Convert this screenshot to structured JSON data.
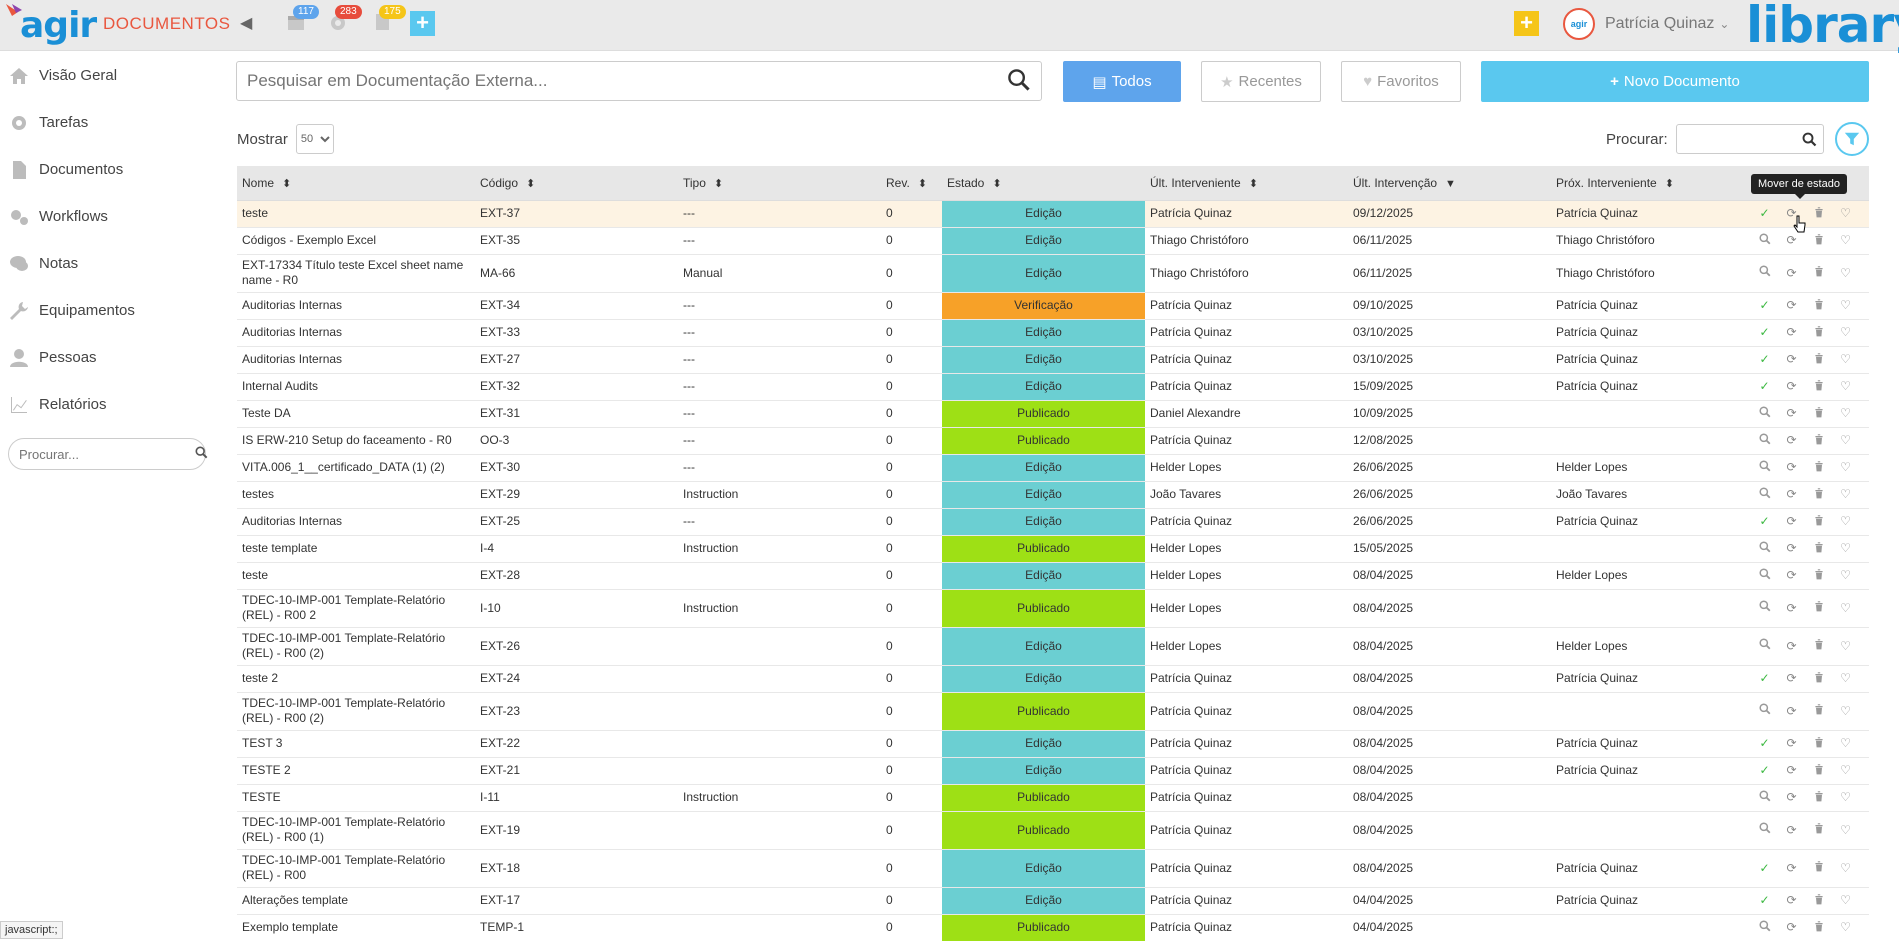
{
  "app": {
    "logo": "agir",
    "name": "DOCUMENTOS",
    "brand": "library",
    "user_name": "Patrícia Quinaz",
    "user_avatar_text": "agir",
    "badges": {
      "tasks": "117",
      "alerts": "283",
      "docs": "175"
    },
    "accent": "#1a8fd6",
    "brand_orange": "#e9573f"
  },
  "sidebar": {
    "items": [
      {
        "label": "Visão Geral",
        "icon": "home-icon"
      },
      {
        "label": "Tarefas",
        "icon": "gear-icon"
      },
      {
        "label": "Documentos",
        "icon": "document-icon"
      },
      {
        "label": "Workflows",
        "icon": "gears-icon"
      },
      {
        "label": "Notas",
        "icon": "comments-icon"
      },
      {
        "label": "Equipamentos",
        "icon": "wrench-icon"
      },
      {
        "label": "Pessoas",
        "icon": "user-icon"
      },
      {
        "label": "Relatórios",
        "icon": "chart-icon"
      }
    ],
    "search_placeholder": "Procurar..."
  },
  "toolbar": {
    "search_placeholder": "Pesquisar em Documentação Externa...",
    "all_label": "Todos",
    "recent_label": "Recentes",
    "favorites_label": "Favoritos",
    "new_label": "Novo Documento",
    "show_label": "Mostrar",
    "show_value": "50",
    "search_label": "Procurar:"
  },
  "table": {
    "headers": {
      "nome": "Nome",
      "codigo": "Código",
      "tipo": "Tipo",
      "rev": "Rev.",
      "estado": "Estado",
      "ult_int": "Últ. Interveniente",
      "ult_date": "Últ. Intervenção",
      "prox": "Próx. Interveniente"
    },
    "rows": [
      {
        "nome": "teste",
        "codigo": "EXT-37",
        "tipo": "---",
        "rev": "0",
        "estado": "Edição",
        "ult": "Patrícia Quinaz",
        "data": "09/12/2025",
        "prox": "Patrícia Quinaz",
        "check": true,
        "hl": true
      },
      {
        "nome": "Códigos - Exemplo Excel",
        "codigo": "EXT-35",
        "tipo": "---",
        "rev": "0",
        "estado": "Edição",
        "ult": "Thiago Christóforo",
        "data": "06/11/2025",
        "prox": "Thiago Christóforo",
        "check": false
      },
      {
        "nome": "EXT-17334 Título teste Excel sheet name name - R0",
        "codigo": "MA-66",
        "tipo": "Manual",
        "rev": "0",
        "estado": "Edição",
        "ult": "Thiago Christóforo",
        "data": "06/11/2025",
        "prox": "Thiago Christóforo",
        "check": false,
        "tall": true
      },
      {
        "nome": "Auditorias Internas",
        "codigo": "EXT-34",
        "tipo": "---",
        "rev": "0",
        "estado": "Verificação",
        "ult": "Patrícia Quinaz",
        "data": "09/10/2025",
        "prox": "Patrícia Quinaz",
        "check": true
      },
      {
        "nome": "Auditorias Internas",
        "codigo": "EXT-33",
        "tipo": "---",
        "rev": "0",
        "estado": "Edição",
        "ult": "Patrícia Quinaz",
        "data": "03/10/2025",
        "prox": "Patrícia Quinaz",
        "check": true
      },
      {
        "nome": "Auditorias Internas",
        "codigo": "EXT-27",
        "tipo": "---",
        "rev": "0",
        "estado": "Edição",
        "ult": "Patrícia Quinaz",
        "data": "03/10/2025",
        "prox": "Patrícia Quinaz",
        "check": true
      },
      {
        "nome": "Internal Audits",
        "codigo": "EXT-32",
        "tipo": "---",
        "rev": "0",
        "estado": "Edição",
        "ult": "Patrícia Quinaz",
        "data": "15/09/2025",
        "prox": "Patrícia Quinaz",
        "check": true
      },
      {
        "nome": "Teste DA",
        "codigo": "EXT-31",
        "tipo": "---",
        "rev": "0",
        "estado": "Publicado",
        "ult": "Daniel Alexandre",
        "data": "10/09/2025",
        "prox": "",
        "check": false
      },
      {
        "nome": "IS ERW-210 Setup do faceamento - R0",
        "codigo": "OO-3",
        "tipo": "---",
        "rev": "0",
        "estado": "Publicado",
        "ult": "Patrícia Quinaz",
        "data": "12/08/2025",
        "prox": "",
        "check": false
      },
      {
        "nome": "VITA.006_1__certificado_DATA (1) (2)",
        "codigo": "EXT-30",
        "tipo": "---",
        "rev": "0",
        "estado": "Edição",
        "ult": "Helder Lopes",
        "data": "26/06/2025",
        "prox": "Helder Lopes",
        "check": false
      },
      {
        "nome": "testes",
        "codigo": "EXT-29",
        "tipo": "Instruction",
        "rev": "0",
        "estado": "Edição",
        "ult": "João Tavares",
        "data": "26/06/2025",
        "prox": "João Tavares",
        "check": false
      },
      {
        "nome": "Auditorias Internas",
        "codigo": "EXT-25",
        "tipo": "---",
        "rev": "0",
        "estado": "Edição",
        "ult": "Patrícia Quinaz",
        "data": "26/06/2025",
        "prox": "Patrícia Quinaz",
        "check": true
      },
      {
        "nome": "teste template",
        "codigo": "I-4",
        "tipo": "Instruction",
        "rev": "0",
        "estado": "Publicado",
        "ult": "Helder Lopes",
        "data": "15/05/2025",
        "prox": "",
        "check": false
      },
      {
        "nome": "teste",
        "codigo": "EXT-28",
        "tipo": "",
        "rev": "0",
        "estado": "Edição",
        "ult": "Helder Lopes",
        "data": "08/04/2025",
        "prox": "Helder Lopes",
        "check": false
      },
      {
        "nome": "TDEC-10-IMP-001 Template-Relatório (REL) - R00 2",
        "codigo": "I-10",
        "tipo": "Instruction",
        "rev": "0",
        "estado": "Publicado",
        "ult": "Helder Lopes",
        "data": "08/04/2025",
        "prox": "",
        "check": false,
        "tall": true
      },
      {
        "nome": "TDEC-10-IMP-001 Template-Relatório (REL) - R00 (2)",
        "codigo": "EXT-26",
        "tipo": "",
        "rev": "0",
        "estado": "Edição",
        "ult": "Helder Lopes",
        "data": "08/04/2025",
        "prox": "Helder Lopes",
        "check": false,
        "tall": true
      },
      {
        "nome": "teste 2",
        "codigo": "EXT-24",
        "tipo": "",
        "rev": "0",
        "estado": "Edição",
        "ult": "Patrícia Quinaz",
        "data": "08/04/2025",
        "prox": "Patrícia Quinaz",
        "check": true
      },
      {
        "nome": "TDEC-10-IMP-001 Template-Relatório (REL) - R00 (2)",
        "codigo": "EXT-23",
        "tipo": "",
        "rev": "0",
        "estado": "Publicado",
        "ult": "Patrícia Quinaz",
        "data": "08/04/2025",
        "prox": "",
        "check": false,
        "tall": true
      },
      {
        "nome": "TEST 3",
        "codigo": "EXT-22",
        "tipo": "",
        "rev": "0",
        "estado": "Edição",
        "ult": "Patrícia Quinaz",
        "data": "08/04/2025",
        "prox": "Patrícia Quinaz",
        "check": true
      },
      {
        "nome": "TESTE 2",
        "codigo": "EXT-21",
        "tipo": "",
        "rev": "0",
        "estado": "Edição",
        "ult": "Patrícia Quinaz",
        "data": "08/04/2025",
        "prox": "Patrícia Quinaz",
        "check": true
      },
      {
        "nome": "TESTE",
        "codigo": "I-11",
        "tipo": "Instruction",
        "rev": "0",
        "estado": "Publicado",
        "ult": "Patrícia Quinaz",
        "data": "08/04/2025",
        "prox": "",
        "check": false
      },
      {
        "nome": "TDEC-10-IMP-001 Template-Relatório (REL) - R00 (1)",
        "codigo": "EXT-19",
        "tipo": "",
        "rev": "0",
        "estado": "Publicado",
        "ult": "Patrícia Quinaz",
        "data": "08/04/2025",
        "prox": "",
        "check": false,
        "tall": true
      },
      {
        "nome": "TDEC-10-IMP-001 Template-Relatório (REL) - R00",
        "codigo": "EXT-18",
        "tipo": "",
        "rev": "0",
        "estado": "Edição",
        "ult": "Patrícia Quinaz",
        "data": "08/04/2025",
        "prox": "Patrícia Quinaz",
        "check": true,
        "tall": true
      },
      {
        "nome": "Alterações template",
        "codigo": "EXT-17",
        "tipo": "",
        "rev": "0",
        "estado": "Edição",
        "ult": "Patrícia Quinaz",
        "data": "04/04/2025",
        "prox": "Patrícia Quinaz",
        "check": true
      },
      {
        "nome": "Exemplo template",
        "codigo": "TEMP-1",
        "tipo": "",
        "rev": "0",
        "estado": "Publicado",
        "ult": "Patrícia Quinaz",
        "data": "04/04/2025",
        "prox": "",
        "check": false
      }
    ]
  },
  "tooltip": "Mover de estado",
  "status_bar": "javascript:;",
  "state_colors": {
    "Edição": "#6bcfd2",
    "Verificação": "#f7a128",
    "Publicado": "#9ee015"
  }
}
